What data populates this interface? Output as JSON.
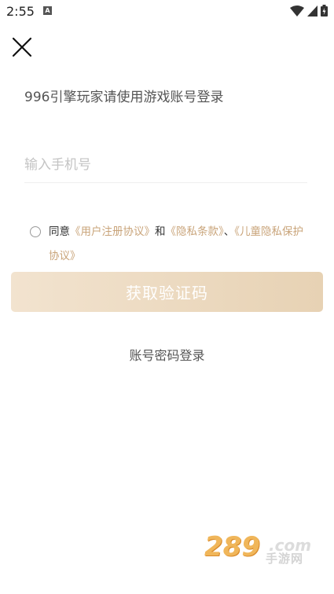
{
  "status_bar": {
    "time": "2:55",
    "notification_glyph": "A",
    "icons": [
      "wifi-icon",
      "cell-signal-icon",
      "battery-icon"
    ]
  },
  "close": {
    "icon": "close-icon"
  },
  "headline": "996引擎玩家请使用游戏账号登录",
  "phone": {
    "placeholder": "输入手机号",
    "value": ""
  },
  "agreement": {
    "checked": false,
    "prefix": "同意",
    "user_agreement": "《用户注册协议》",
    "and": "和",
    "privacy": "《隐私条款》",
    "separator": "、",
    "child_privacy": "《儿童隐私保护协议》"
  },
  "actions": {
    "get_code": "获取验证码",
    "password_login": "账号密码登录"
  },
  "watermark": {
    "number": "289",
    "domain": ".com",
    "chinese": "手游网"
  },
  "colors": {
    "link": "#c9a47a",
    "button_gradient_start": "#f2e3cf",
    "button_gradient_end": "#e7d2b4"
  }
}
